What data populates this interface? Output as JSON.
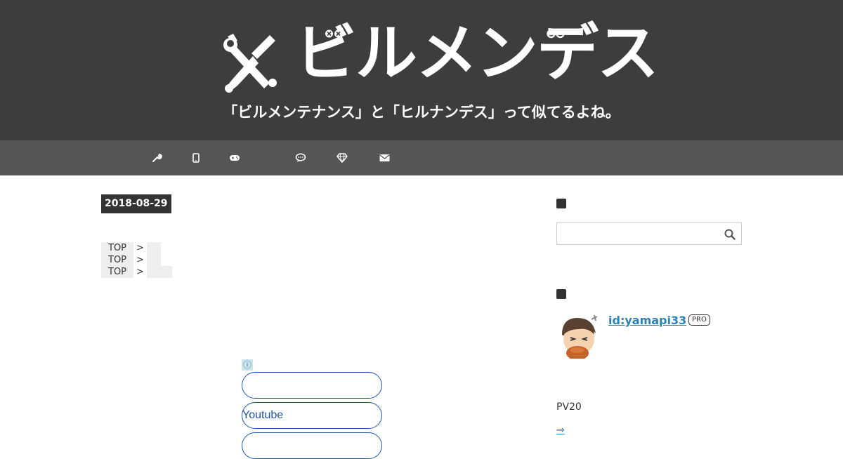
{
  "header": {
    "logo_text": "ビルメンデス",
    "tagline": "「ビルメンテナンス」と「ヒルナンデス」って似てるよね。",
    "background_color": "#3d3d3d"
  },
  "nav": {
    "background_color": "#555555",
    "icons": [
      "wrench-icon",
      "smartphone-icon",
      "gamepad-icon",
      "speech-bubble-icon",
      "diamond-icon",
      "envelope-icon"
    ]
  },
  "article": {
    "date": "2018-08-29",
    "breadcrumbs": [
      {
        "top": "TOP",
        "sep": ">"
      },
      {
        "top": "TOP",
        "sep": ">"
      },
      {
        "top": "TOP",
        "sep": ">"
      }
    ],
    "ad": {
      "info_symbol": "ⓘ",
      "buttons": [
        "",
        "Youtube",
        ""
      ]
    }
  },
  "sidebar": {
    "search": {
      "placeholder": "",
      "value": ""
    },
    "profile": {
      "id": "id:yamapi33",
      "badge": "PRO"
    },
    "pv_text": "PV20",
    "arrow_link": "⇒"
  },
  "colors": {
    "link": "#2b82b8",
    "ad_button_border": "#1a56b0"
  }
}
